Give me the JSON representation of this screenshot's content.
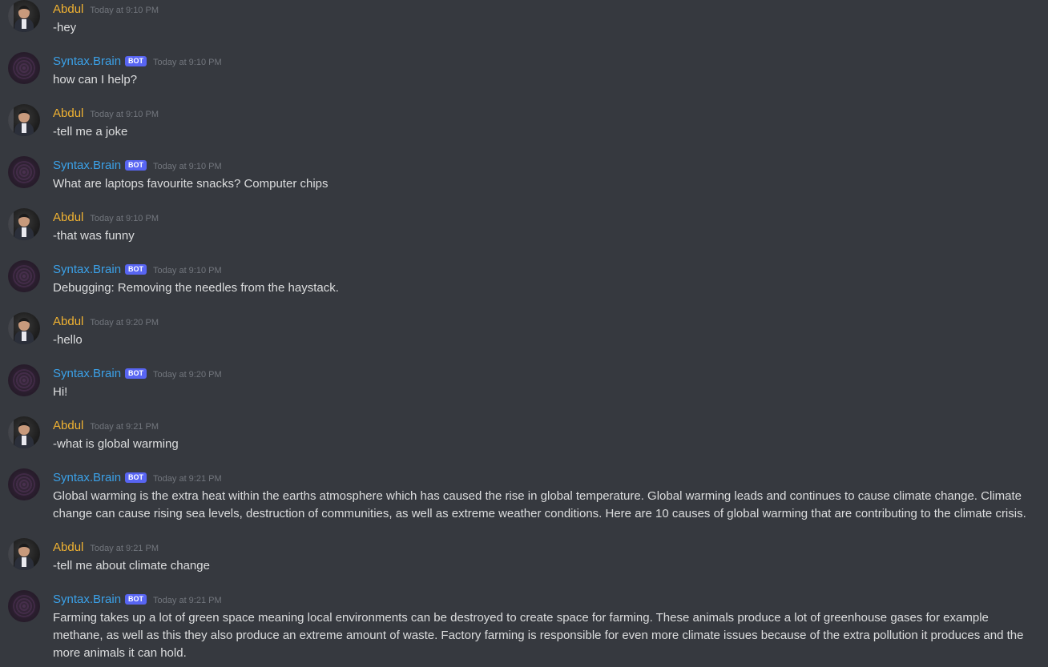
{
  "bot_tag_label": "BOT",
  "colors": {
    "background": "#36393f",
    "user_name": "#f0b232",
    "bot_name": "#3ba1e8",
    "bot_tag": "#5865f2",
    "message_text": "#dcddde",
    "timestamp": "#72767d"
  },
  "messages": [
    {
      "author": "Abdul",
      "is_bot": false,
      "timestamp": "Today at 9:10 PM",
      "text": "-hey"
    },
    {
      "author": "Syntax.Brain",
      "is_bot": true,
      "timestamp": "Today at 9:10 PM",
      "text": "how can I help?"
    },
    {
      "author": "Abdul",
      "is_bot": false,
      "timestamp": "Today at 9:10 PM",
      "text": "-tell me a joke"
    },
    {
      "author": "Syntax.Brain",
      "is_bot": true,
      "timestamp": "Today at 9:10 PM",
      "text": "What are laptops favourite snacks? Computer chips"
    },
    {
      "author": "Abdul",
      "is_bot": false,
      "timestamp": "Today at 9:10 PM",
      "text": "-that was funny"
    },
    {
      "author": "Syntax.Brain",
      "is_bot": true,
      "timestamp": "Today at 9:10 PM",
      "text": "Debugging: Removing the needles from the haystack."
    },
    {
      "author": "Abdul",
      "is_bot": false,
      "timestamp": "Today at 9:20 PM",
      "text": "-hello"
    },
    {
      "author": "Syntax.Brain",
      "is_bot": true,
      "timestamp": "Today at 9:20 PM",
      "text": "Hi!"
    },
    {
      "author": "Abdul",
      "is_bot": false,
      "timestamp": "Today at 9:21 PM",
      "text": "-what is global warming"
    },
    {
      "author": "Syntax.Brain",
      "is_bot": true,
      "timestamp": "Today at 9:21 PM",
      "text": "Global warming is the extra heat within the earths atmosphere which has caused the rise in global temperature. Global warming leads and continues to cause climate change. Climate change can cause rising sea levels, destruction of communities, as well as extreme weather conditions. Here are 10 causes of global warming that are contributing to the climate crisis."
    },
    {
      "author": "Abdul",
      "is_bot": false,
      "timestamp": "Today at 9:21 PM",
      "text": "-tell me about climate change"
    },
    {
      "author": "Syntax.Brain",
      "is_bot": true,
      "timestamp": "Today at 9:21 PM",
      "text": "Farming takes up a lot of green space meaning local environments can be destroyed to create space for farming. These animals produce a lot of greenhouse gases for example methane, as well as this they also produce an extreme amount of waste. Factory farming is responsible for even more climate issues because of the extra pollution it produces and the more animals it can hold."
    }
  ]
}
